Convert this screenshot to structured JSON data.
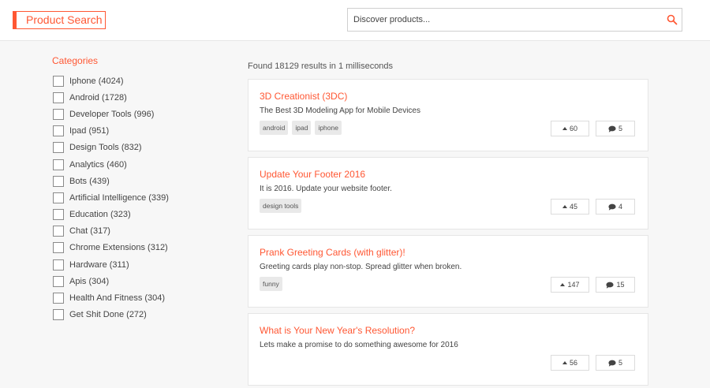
{
  "header": {
    "logo": "Product Search",
    "search_placeholder": "Discover products..."
  },
  "sidebar": {
    "title": "Categories",
    "items": [
      {
        "label": "Iphone (4024)"
      },
      {
        "label": "Android (1728)"
      },
      {
        "label": "Developer Tools (996)"
      },
      {
        "label": "Ipad (951)"
      },
      {
        "label": "Design Tools (832)"
      },
      {
        "label": "Analytics (460)"
      },
      {
        "label": "Bots (439)"
      },
      {
        "label": "Artificial Intelligence (339)"
      },
      {
        "label": "Education (323)"
      },
      {
        "label": "Chat (317)"
      },
      {
        "label": "Chrome Extensions (312)"
      },
      {
        "label": "Hardware (311)"
      },
      {
        "label": "Apis (304)"
      },
      {
        "label": "Health And Fitness (304)"
      },
      {
        "label": "Get Shit Done (272)"
      }
    ]
  },
  "results": {
    "summary": "Found 18129 results in 1 milliseconds",
    "items": [
      {
        "title": "3D Creationist (3DC)",
        "description": "The Best 3D Modeling App for Mobile Devices",
        "tags": [
          "android",
          "ipad",
          "iphone"
        ],
        "votes": "60",
        "comments": "5"
      },
      {
        "title": "Update Your Footer 2016",
        "description": "It is 2016. Update your website footer.",
        "tags": [
          "design tools"
        ],
        "votes": "45",
        "comments": "4"
      },
      {
        "title": "Prank Greeting Cards (with glitter)!",
        "description": "Greeting cards play non-stop. Spread glitter when broken.",
        "tags": [
          "funny"
        ],
        "votes": "147",
        "comments": "15"
      },
      {
        "title": "What is Your New Year's Resolution?",
        "description": "Lets make a promise to do something awesome for 2016",
        "tags": [],
        "votes": "56",
        "comments": "5"
      }
    ]
  },
  "colors": {
    "accent": "#ff5733",
    "background": "#f7f7f7"
  }
}
